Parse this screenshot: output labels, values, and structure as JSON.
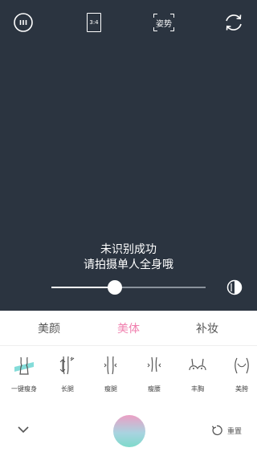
{
  "camera": {
    "ratio_label": "3:4",
    "pose_label": "姿势",
    "message_line1": "未识别成功",
    "message_line2": "请拍摄单人全身哦",
    "slider_value_percent": 41,
    "icons": [
      "menu-icon",
      "aspect-ratio-icon",
      "pose-icon",
      "switch-camera-icon",
      "contrast-icon"
    ]
  },
  "tabs": [
    {
      "label": "美颜",
      "active": false
    },
    {
      "label": "美体",
      "active": true
    },
    {
      "label": "补妆",
      "active": false
    }
  ],
  "features": [
    {
      "label": "一键瘦身",
      "icon": "body-slim-icon"
    },
    {
      "label": "长腿",
      "icon": "long-legs-icon"
    },
    {
      "label": "瘦腿",
      "icon": "slim-legs-icon"
    },
    {
      "label": "瘦腰",
      "icon": "slim-waist-icon"
    },
    {
      "label": "丰胸",
      "icon": "bust-icon"
    },
    {
      "label": "美胯",
      "icon": "hips-icon"
    }
  ],
  "bottom": {
    "reset_label": "重置"
  },
  "colors": {
    "viewfinder_bg": "#2b3440",
    "accent": "#f07fae",
    "feature_highlight": "#6fd6d2"
  }
}
